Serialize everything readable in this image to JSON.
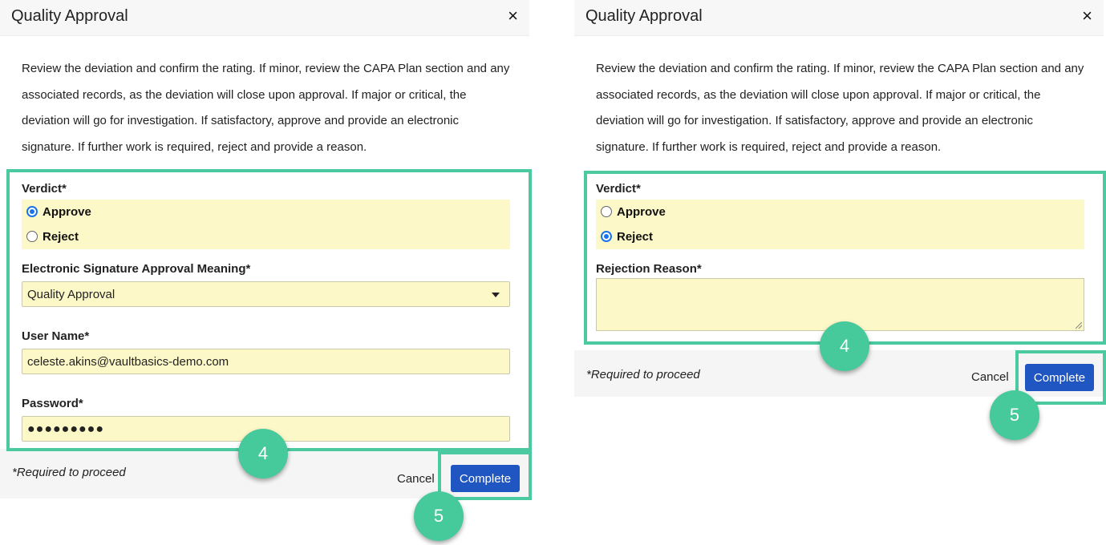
{
  "left_dialog": {
    "title": "Quality Approval",
    "close_icon": "×",
    "description_lines": [
      "Review the deviation and confirm the rating. If minor, review the CAPA Plan section and any",
      "associated records, as the deviation will close upon approval. If major or critical, the",
      "deviation will go for investigation. If satisfactory, approve and provide an electronic",
      "signature. If further work is required, reject and provide a reason."
    ],
    "verdict_label": "Verdict*",
    "approve_label": "Approve",
    "reject_label": "Reject",
    "selected_verdict": "Approve",
    "meaning_label": "Electronic Signature Approval Meaning*",
    "meaning_value": "Quality Approval",
    "username_label": "User Name*",
    "username_value": "celeste.akins@vaultbasics-demo.com",
    "password_label": "Password*",
    "password_value": "●●●●●●●●●",
    "required_note": "*Required to proceed",
    "cancel_label": "Cancel",
    "complete_label": "Complete",
    "callout_fields": "4",
    "callout_complete": "5"
  },
  "right_dialog": {
    "title": "Quality Approval",
    "close_icon": "×",
    "description_lines": [
      "Review the deviation and confirm the rating. If minor, review the CAPA Plan section and any",
      "associated records, as the deviation will close upon approval. If major or critical, the",
      "deviation will go for investigation. If satisfactory, approve and provide an electronic",
      "signature. If further work is required, reject and provide a reason."
    ],
    "verdict_label": "Verdict*",
    "approve_label": "Approve",
    "reject_label": "Reject",
    "selected_verdict": "Reject",
    "rejection_label": "Rejection Reason*",
    "rejection_value": "",
    "required_note": "*Required to proceed",
    "cancel_label": "Cancel",
    "complete_label": "Complete",
    "callout_fields": "4",
    "callout_complete": "5"
  },
  "colors": {
    "highlight_border": "#4bc9a0",
    "callout": "#46c99b",
    "field_background": "#fdf8c8",
    "primary_button": "#1f56c2",
    "radio_selected": "#1a73e8"
  }
}
